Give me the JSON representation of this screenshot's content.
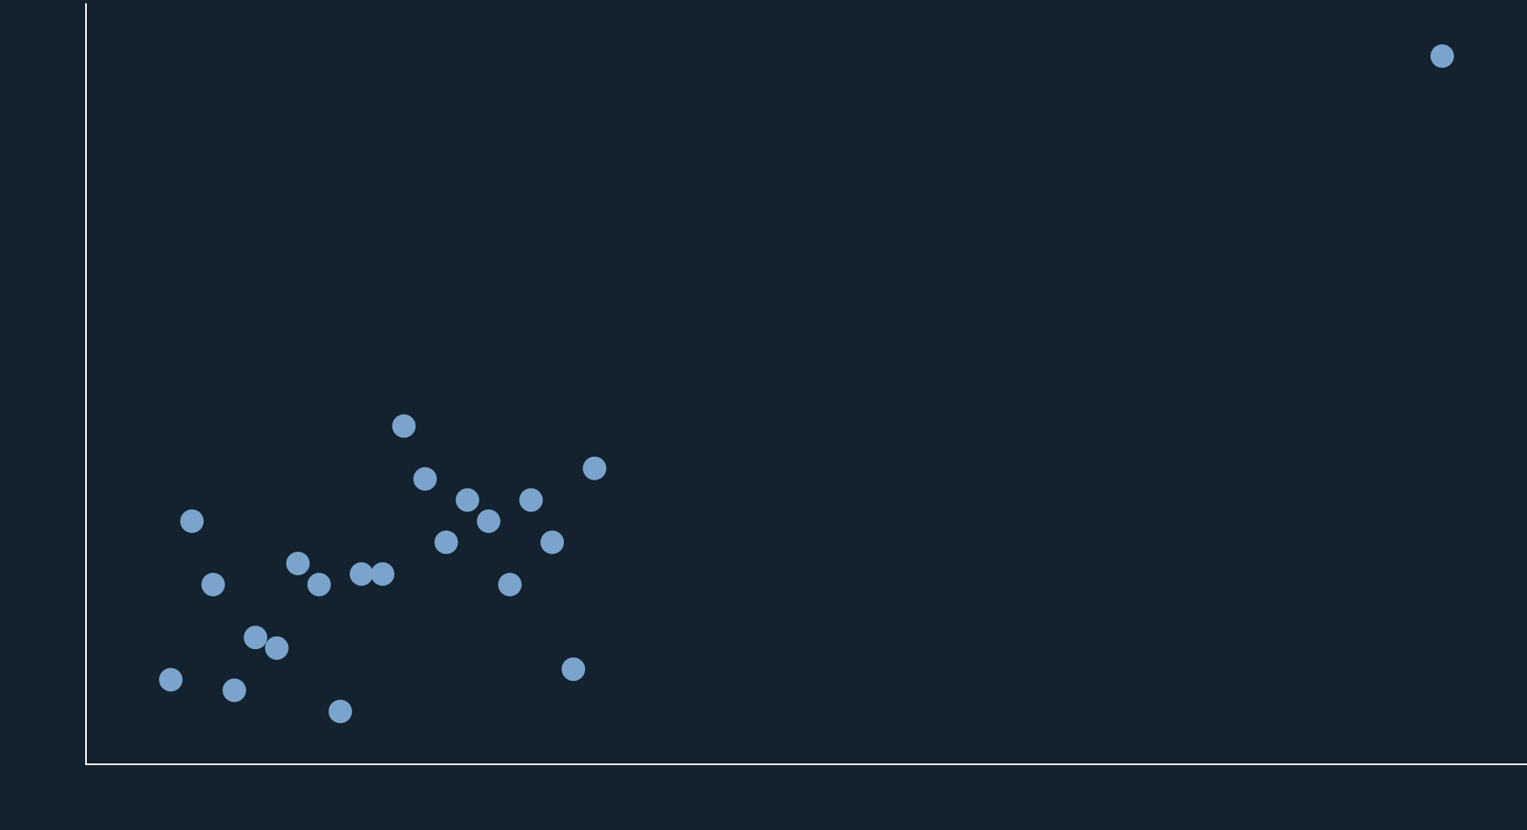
{
  "chart_data": {
    "type": "scatter",
    "title": "",
    "xlabel": "",
    "ylabel": "",
    "grid": false,
    "legend": false,
    "xlim": [
      0,
      68
    ],
    "ylim": [
      0,
      72
    ],
    "point_color": "#7aa4cc",
    "axis_color": "#ffffff",
    "background": "#14212e",
    "series": [
      {
        "points": [
          {
            "x": 4,
            "y": 8
          },
          {
            "x": 5,
            "y": 23
          },
          {
            "x": 6,
            "y": 17
          },
          {
            "x": 7,
            "y": 7
          },
          {
            "x": 8,
            "y": 12
          },
          {
            "x": 9,
            "y": 11
          },
          {
            "x": 10,
            "y": 19
          },
          {
            "x": 11,
            "y": 17
          },
          {
            "x": 12,
            "y": 5
          },
          {
            "x": 13,
            "y": 18
          },
          {
            "x": 14,
            "y": 18
          },
          {
            "x": 15,
            "y": 32
          },
          {
            "x": 16,
            "y": 27
          },
          {
            "x": 17,
            "y": 21
          },
          {
            "x": 18,
            "y": 25
          },
          {
            "x": 19,
            "y": 23
          },
          {
            "x": 20,
            "y": 17
          },
          {
            "x": 21,
            "y": 25
          },
          {
            "x": 22,
            "y": 21
          },
          {
            "x": 23,
            "y": 9
          },
          {
            "x": 24,
            "y": 28
          },
          {
            "x": 64,
            "y": 67
          }
        ]
      }
    ]
  }
}
